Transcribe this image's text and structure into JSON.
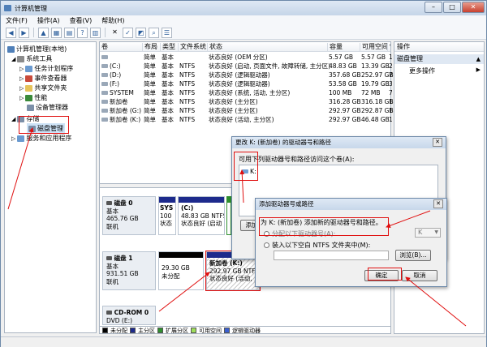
{
  "window": {
    "title": "计算机管理"
  },
  "menu": [
    "文件(F)",
    "操作(A)",
    "查看(V)",
    "帮助(H)"
  ],
  "tree": {
    "root": "计算机管理(本地)",
    "system_tools": "系统工具",
    "task_scheduler": "任务计划程序",
    "event_viewer": "事件查看器",
    "shared_folders": "共享文件夹",
    "perf": "性能",
    "device_mgr": "设备管理器",
    "storage": "存储",
    "disk_mgmt": "磁盘管理",
    "services": "服务和应用程序"
  },
  "volume_table": {
    "headers": [
      "卷",
      "布局",
      "类型",
      "文件系统",
      "状态",
      "容量",
      "可用空间",
      "%"
    ],
    "rows": [
      [
        "",
        "简单",
        "基本",
        "",
        "状态良好 (OEM 分区)",
        "5.57 GB",
        "5.57 GB",
        "1"
      ],
      [
        "(C:)",
        "简单",
        "基本",
        "NTFS",
        "状态良好 (启动, 页面文件, 故障转储, 主分区)",
        "48.83 GB",
        "13.39 GB",
        "2"
      ],
      [
        "(D:)",
        "简单",
        "基本",
        "NTFS",
        "状态良好 (逻辑驱动器)",
        "357.68 GB",
        "252.97 GB",
        "7"
      ],
      [
        "(F:)",
        "简单",
        "基本",
        "NTFS",
        "状态良好 (逻辑驱动器)",
        "53.58 GB",
        "19.79 GB",
        "3"
      ],
      [
        "SYSTEM",
        "简单",
        "基本",
        "NTFS",
        "状态良好 (系统, 活动, 主分区)",
        "100 MB",
        "72 MB",
        "7"
      ],
      [
        "新加卷",
        "简单",
        "基本",
        "NTFS",
        "状态良好 (主分区)",
        "316.28 GB",
        "316.18 GB",
        "1"
      ],
      [
        "新加卷 (G:)",
        "简单",
        "基本",
        "NTFS",
        "状态良好 (主分区)",
        "292.97 GB",
        "292.87 GB",
        "1"
      ],
      [
        "新加卷 (K:)",
        "简单",
        "基本",
        "NTFS",
        "状态良好 (活动, 主分区)",
        "292.97 GB",
        "46.48 GB",
        "1"
      ]
    ]
  },
  "disk0": {
    "name": "磁盘 0",
    "type": "基本",
    "size": "465.76 GB",
    "status": "联机",
    "p1_name": "SYS",
    "p1_size": "100",
    "p1_status": "状态",
    "p2_name": "(C:)",
    "p2_size": "48.83 GB NTFS",
    "p2_status": "状态良好 (启动"
  },
  "disk1": {
    "name": "磁盘 1",
    "type": "基本",
    "size": "931.51 GB",
    "status": "联机",
    "p1_size": "29.30 GB",
    "p1_status": "未分配",
    "p2_name": "新加卷 (K:)",
    "p2_size": "292.97 GB NTFS",
    "p2_status": "状态良好 (活动, 主"
  },
  "cdrom": {
    "name": "CD-ROM 0",
    "line": "DVD (E:)"
  },
  "legend": [
    "未分配",
    "主分区",
    "扩展分区",
    "可用空间",
    "逻辑驱动器"
  ],
  "actions": {
    "header": "操作",
    "section": "磁盘管理",
    "more": "更多操作"
  },
  "dialog1": {
    "title": "更改 K: (新加卷) 的驱动器号和路径",
    "label": "可用下列驱动器号和路径访问这个卷(A):",
    "item": "K:",
    "add_btn": "添加"
  },
  "dialog2": {
    "title": "添加驱动器号或路径",
    "desc": "为 K: (新加卷) 添加新的驱动器号和路径。",
    "opt1": "分配以下驱动器号(A):",
    "opt1_value": "K",
    "opt2": "装入以下空白 NTFS 文件夹中(M):",
    "browse": "浏览(B)...",
    "ok": "确定",
    "cancel": "取消"
  },
  "colors": {
    "primary": "#1d2a8c",
    "unallocated": "#000000",
    "extended": "#2f8f2f",
    "free": "#9ede5b",
    "logical": "#3a5fd0",
    "annotation": "#e01010"
  }
}
